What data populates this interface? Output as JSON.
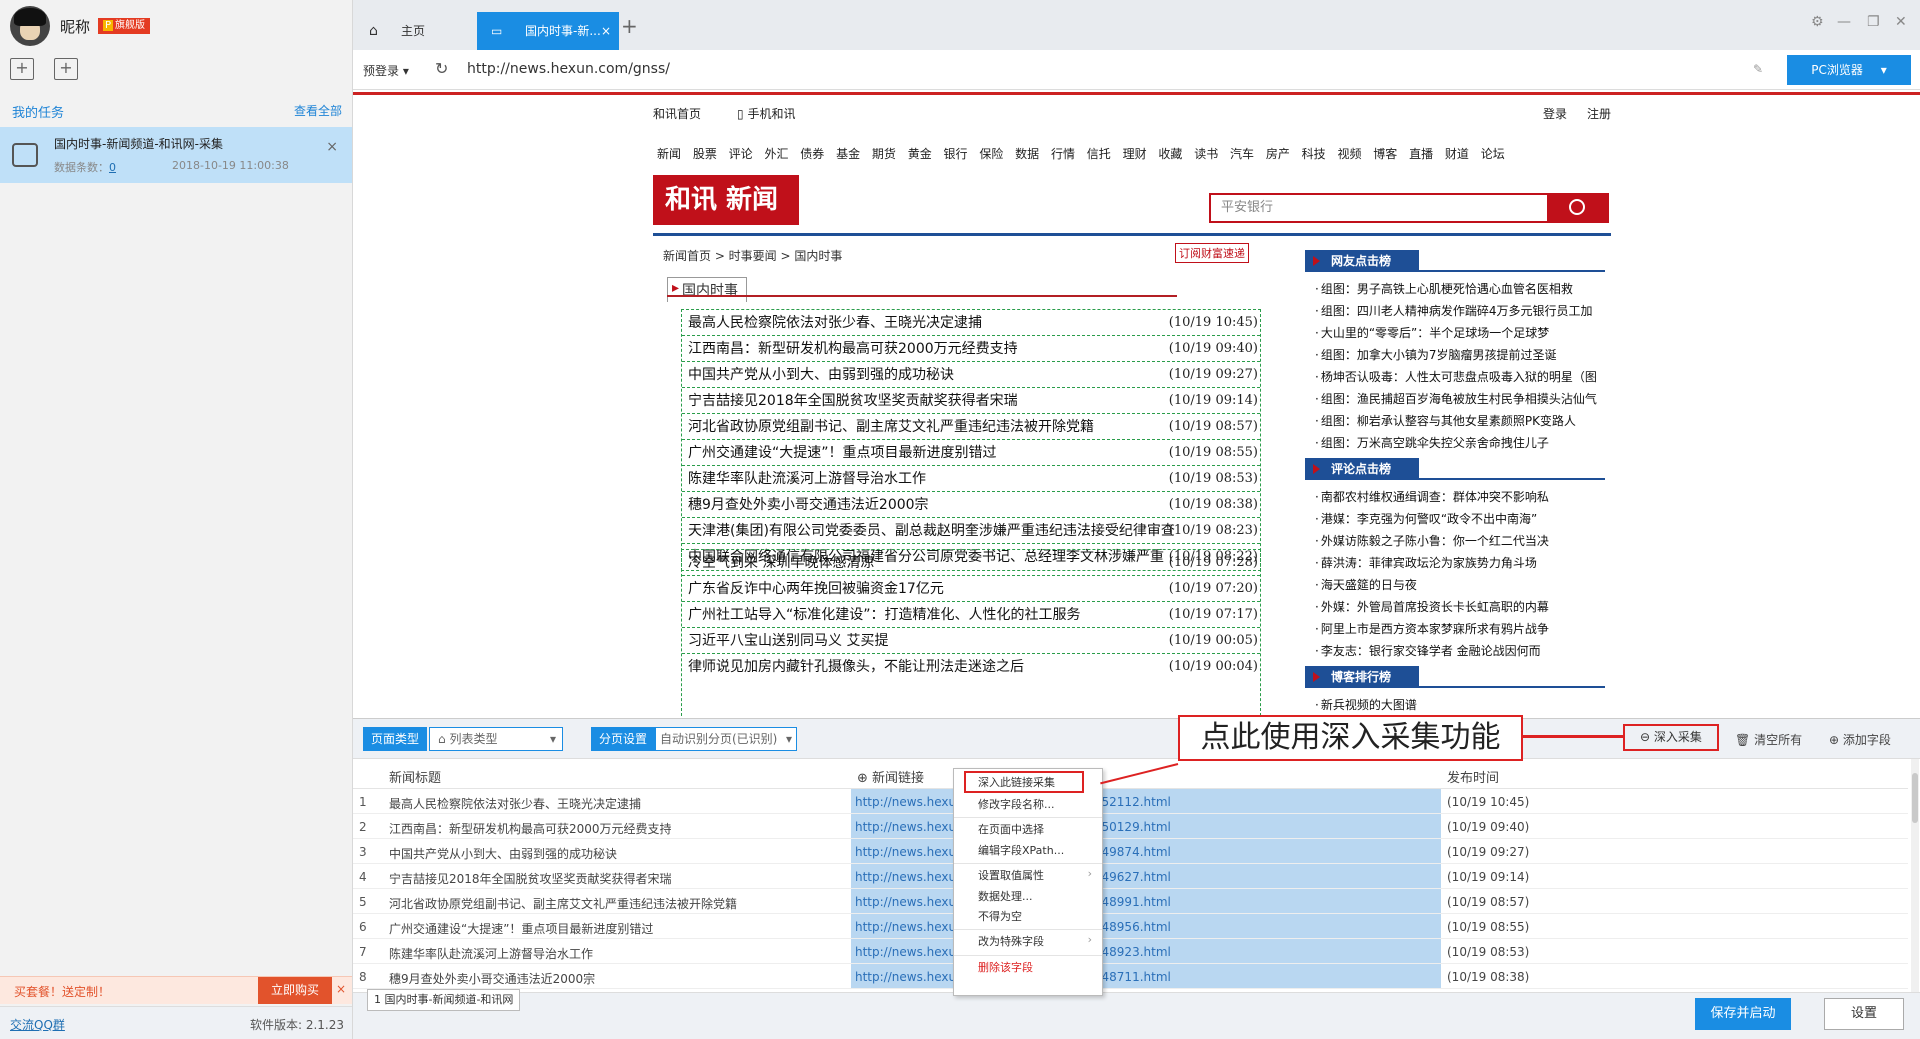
{
  "sidebar": {
    "nickname": "昵称",
    "vip_badge": "旗舰版",
    "vip_letter": "P",
    "my_tasks": "我的任务",
    "view_all": "查看全部",
    "task": {
      "title": "国内时事-新闻频道-和讯网-采集",
      "count_label": "数据条数：",
      "count_value": "0",
      "datetime": "2018-10-19 11:00:38"
    },
    "promo_text": "买套餐！送定制！",
    "promo_button": "立即购买",
    "qq_group": "交流QQ群",
    "version": "软件版本: 2.1.23"
  },
  "tabs": {
    "home": "主页",
    "current": "国内时事-新..."
  },
  "address": {
    "prelogin": "预登录",
    "url": "http://news.hexun.com/gnss/",
    "pc_browser": "PC浏览器"
  },
  "webpage": {
    "nav_home": "和讯首页",
    "nav_mobile": "手机和讯",
    "login": "登录",
    "register": "注册",
    "categories": "新闻 股票 评论 外汇 债券 基金 期货 黄金 银行 保险 数据 行情 信托 理财 收藏 读书 汽车 房产 科技 视频 博客 直播 财道 论坛",
    "logo_text": "和讯 新闻",
    "search_placeholder": "平安银行",
    "breadcrumb": "新闻首页 > 时事要闻 > 国内时事",
    "subscribe": "订阅财富速递",
    "section_title": "国内时事",
    "news_group1": [
      {
        "title": "最高人民检察院依法对张少春、王晓光决定逮捕",
        "date": "(10/19 10:45)"
      },
      {
        "title": "江西南昌：新型研发机构最高可获2000万元经费支持",
        "date": "(10/19 09:40)"
      },
      {
        "title": "中国共产党从小到大、由弱到强的成功秘诀",
        "date": "(10/19 09:27)"
      },
      {
        "title": "宁吉喆接见2018年全国脱贫攻坚奖贡献奖获得者宋瑞",
        "date": "(10/19 09:14)"
      },
      {
        "title": "河北省政协原党组副书记、副主席艾文礼严重违纪违法被开除党籍",
        "date": "(10/19 08:57)"
      },
      {
        "title": "广州交通建设“大提速”！重点项目最新进度别错过",
        "date": "(10/19 08:55)"
      },
      {
        "title": "陈建华率队赴流溪河上游督导治水工作",
        "date": "(10/19 08:53)"
      },
      {
        "title": "穗9月查处外卖小哥交通违法近2000宗",
        "date": "(10/19 08:38)"
      },
      {
        "title": "天津港(集团)有限公司党委委员、副总裁赵明奎涉嫌严重违纪违法接受纪律审查",
        "date": "(10/19 08:23)"
      },
      {
        "title": "中国联合网络通信有限公司福建省分公司原党委书记、总经理李文林涉嫌严重",
        "date": "(10/19 08:22)"
      }
    ],
    "news_group2": [
      {
        "title": "冷空气到来 深圳早晚体感清凉",
        "date": "(10/19 07:28)"
      },
      {
        "title": "广东省反诈中心两年挽回被骗资金17亿元",
        "date": "(10/19 07:20)"
      },
      {
        "title": "广州社工站导入“标准化建设”：打造精准化、人性化的社工服务",
        "date": "(10/19 07:17)"
      },
      {
        "title": "习近平八宝山送别同马义 艾买提",
        "date": "(10/19 00:05)"
      },
      {
        "title": "律师说见加房内藏针孔摄像头，不能让刑法走迷途之后",
        "date": "(10/19 00:04)"
      }
    ],
    "rank1_title": "网友点击榜",
    "rank1": [
      "组图：男子高铁上心肌梗死恰遇心血管名医相救",
      "组图：四川老人精神病发作踹碎4万多元银行员工加",
      "大山里的“零零后”：半个足球场一个足球梦",
      "组图：加拿大小镇为7岁脑瘤男孩提前过圣诞",
      "杨坤否认吸毒：人性太可悲盘点吸毒入狱的明星（图",
      "组图：渔民捕超百岁海龟被放生村民争相摸头沾仙气",
      "组图：柳岩承认整容与其他女星素颜照PK变路人",
      "组图：万米高空跳伞失控父亲舍命拽住儿子"
    ],
    "rank2_title": "评论点击榜",
    "rank2": [
      "南都农村维权通缉调查：群体冲突不影响私",
      "港媒：李克强为何警叹“政令不出中南海”",
      "外媒访陈毅之子陈小鲁：你一个红二代当决",
      "薛洪涛：菲律宾政坛沦为家族势力角斗场",
      "海天盛筵的日与夜",
      "外媒：外管局首席投资长卡长虹高职的内幕",
      "阿里上市是西方资本家梦寐所求有鸦片战争",
      "李友志：银行家交锋学者 金融论战因何而"
    ],
    "rank3_title": "博客排行榜",
    "rank3_partial": "新兵视频的大图谱"
  },
  "panel": {
    "page_type_label": "页面类型",
    "page_type_value": "列表类型",
    "paging_label": "分页设置",
    "paging_value": "自动识别分页(已识别)",
    "callout": "点此使用深入采集功能",
    "deep_collect": "深入采集",
    "clear_all": "清空所有",
    "add_field": "添加字段",
    "col_title": "新闻标题",
    "col_link": "新闻链接",
    "col_time": "发布时间",
    "rows": [
      {
        "n": "1",
        "title": "最高人民检察院依法对张少春、王晓光决定逮捕",
        "link": "http://news.hexun.com/2018-10-19/194952112.html",
        "time": "(10/19 10:45)"
      },
      {
        "n": "2",
        "title": "江西南昌：新型研发机构最高可获2000万元经费支持",
        "link": "http://news.hexun.com/2018-10-19/194950129.html",
        "time": "(10/19 09:40)"
      },
      {
        "n": "3",
        "title": "中国共产党从小到大、由弱到强的成功秘诀",
        "link": "http://news.hexun.com/2018-10-19/194949874.html",
        "time": "(10/19 09:27)"
      },
      {
        "n": "4",
        "title": "宁吉喆接见2018年全国脱贫攻坚奖贡献奖获得者宋瑞",
        "link": "http://news.hexun.com/2018-10-19/194949627.html",
        "time": "(10/19 09:14)"
      },
      {
        "n": "5",
        "title": "河北省政协原党组副书记、副主席艾文礼严重违纪违法被开除党籍",
        "link": "http://news.hexun.com/2018-10-19/194948991.html",
        "time": "(10/19 08:57)"
      },
      {
        "n": "6",
        "title": "广州交通建设“大提速”！重点项目最新进度别错过",
        "link": "http://news.hexun.com/2018-10-19/194948956.html",
        "time": "(10/19 08:55)"
      },
      {
        "n": "7",
        "title": "陈建华率队赴流溪河上游督导治水工作",
        "link": "http://news.hexun.com/2018-10-19/194948923.html",
        "time": "(10/19 08:53)"
      },
      {
        "n": "8",
        "title": "穗9月查处外卖小哥交通违法近2000宗",
        "link": "http://news.hexun.com/2018-10-19/194948711.html",
        "time": "(10/19 08:38)"
      }
    ],
    "context_menu": {
      "deep_link": "深入此链接采集",
      "rename": "修改字段名称...",
      "select_in_page": "在页面中选择",
      "edit_xpath": "编辑字段XPath...",
      "value_attr": "设置取值属性",
      "data_process": "数据处理...",
      "not_empty": "不得为空",
      "special_field": "改为特殊字段",
      "delete": "删除该字段"
    },
    "bottom_tab": "1 国内时事-新闻频道-和讯网",
    "save_start": "保存并启动",
    "settings": "设置"
  }
}
